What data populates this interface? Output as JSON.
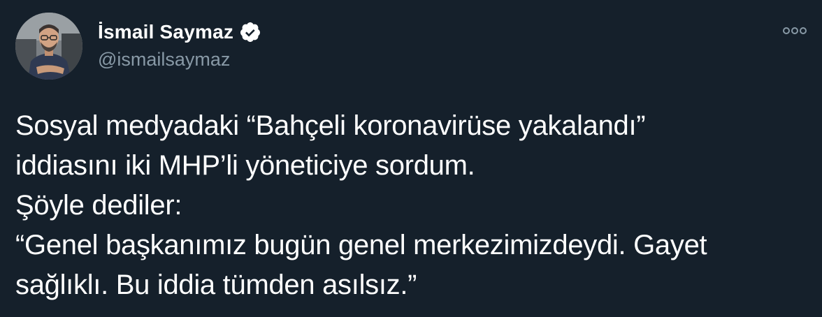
{
  "author": {
    "display_name": "İsmail Saymaz",
    "handle": "@ismailsaymaz",
    "verified": true,
    "avatar_icon": "profile-photo"
  },
  "more_icon": "more-options-icon",
  "tweet": {
    "lines": [
      "Sosyal medyadaki “Bahçeli koronavirüse yakalandı”",
      "iddiasını iki MHP’li yöneticiye sordum.",
      "Şöyle dediler:",
      "“Genel başkanımız bugün genel merkezimizdeydi. Gayet",
      "sağlıklı. Bu iddia tümden asılsız.”"
    ]
  },
  "colors": {
    "background": "#15202b",
    "text_primary": "#ffffff",
    "text_secondary": "#8899a6"
  }
}
